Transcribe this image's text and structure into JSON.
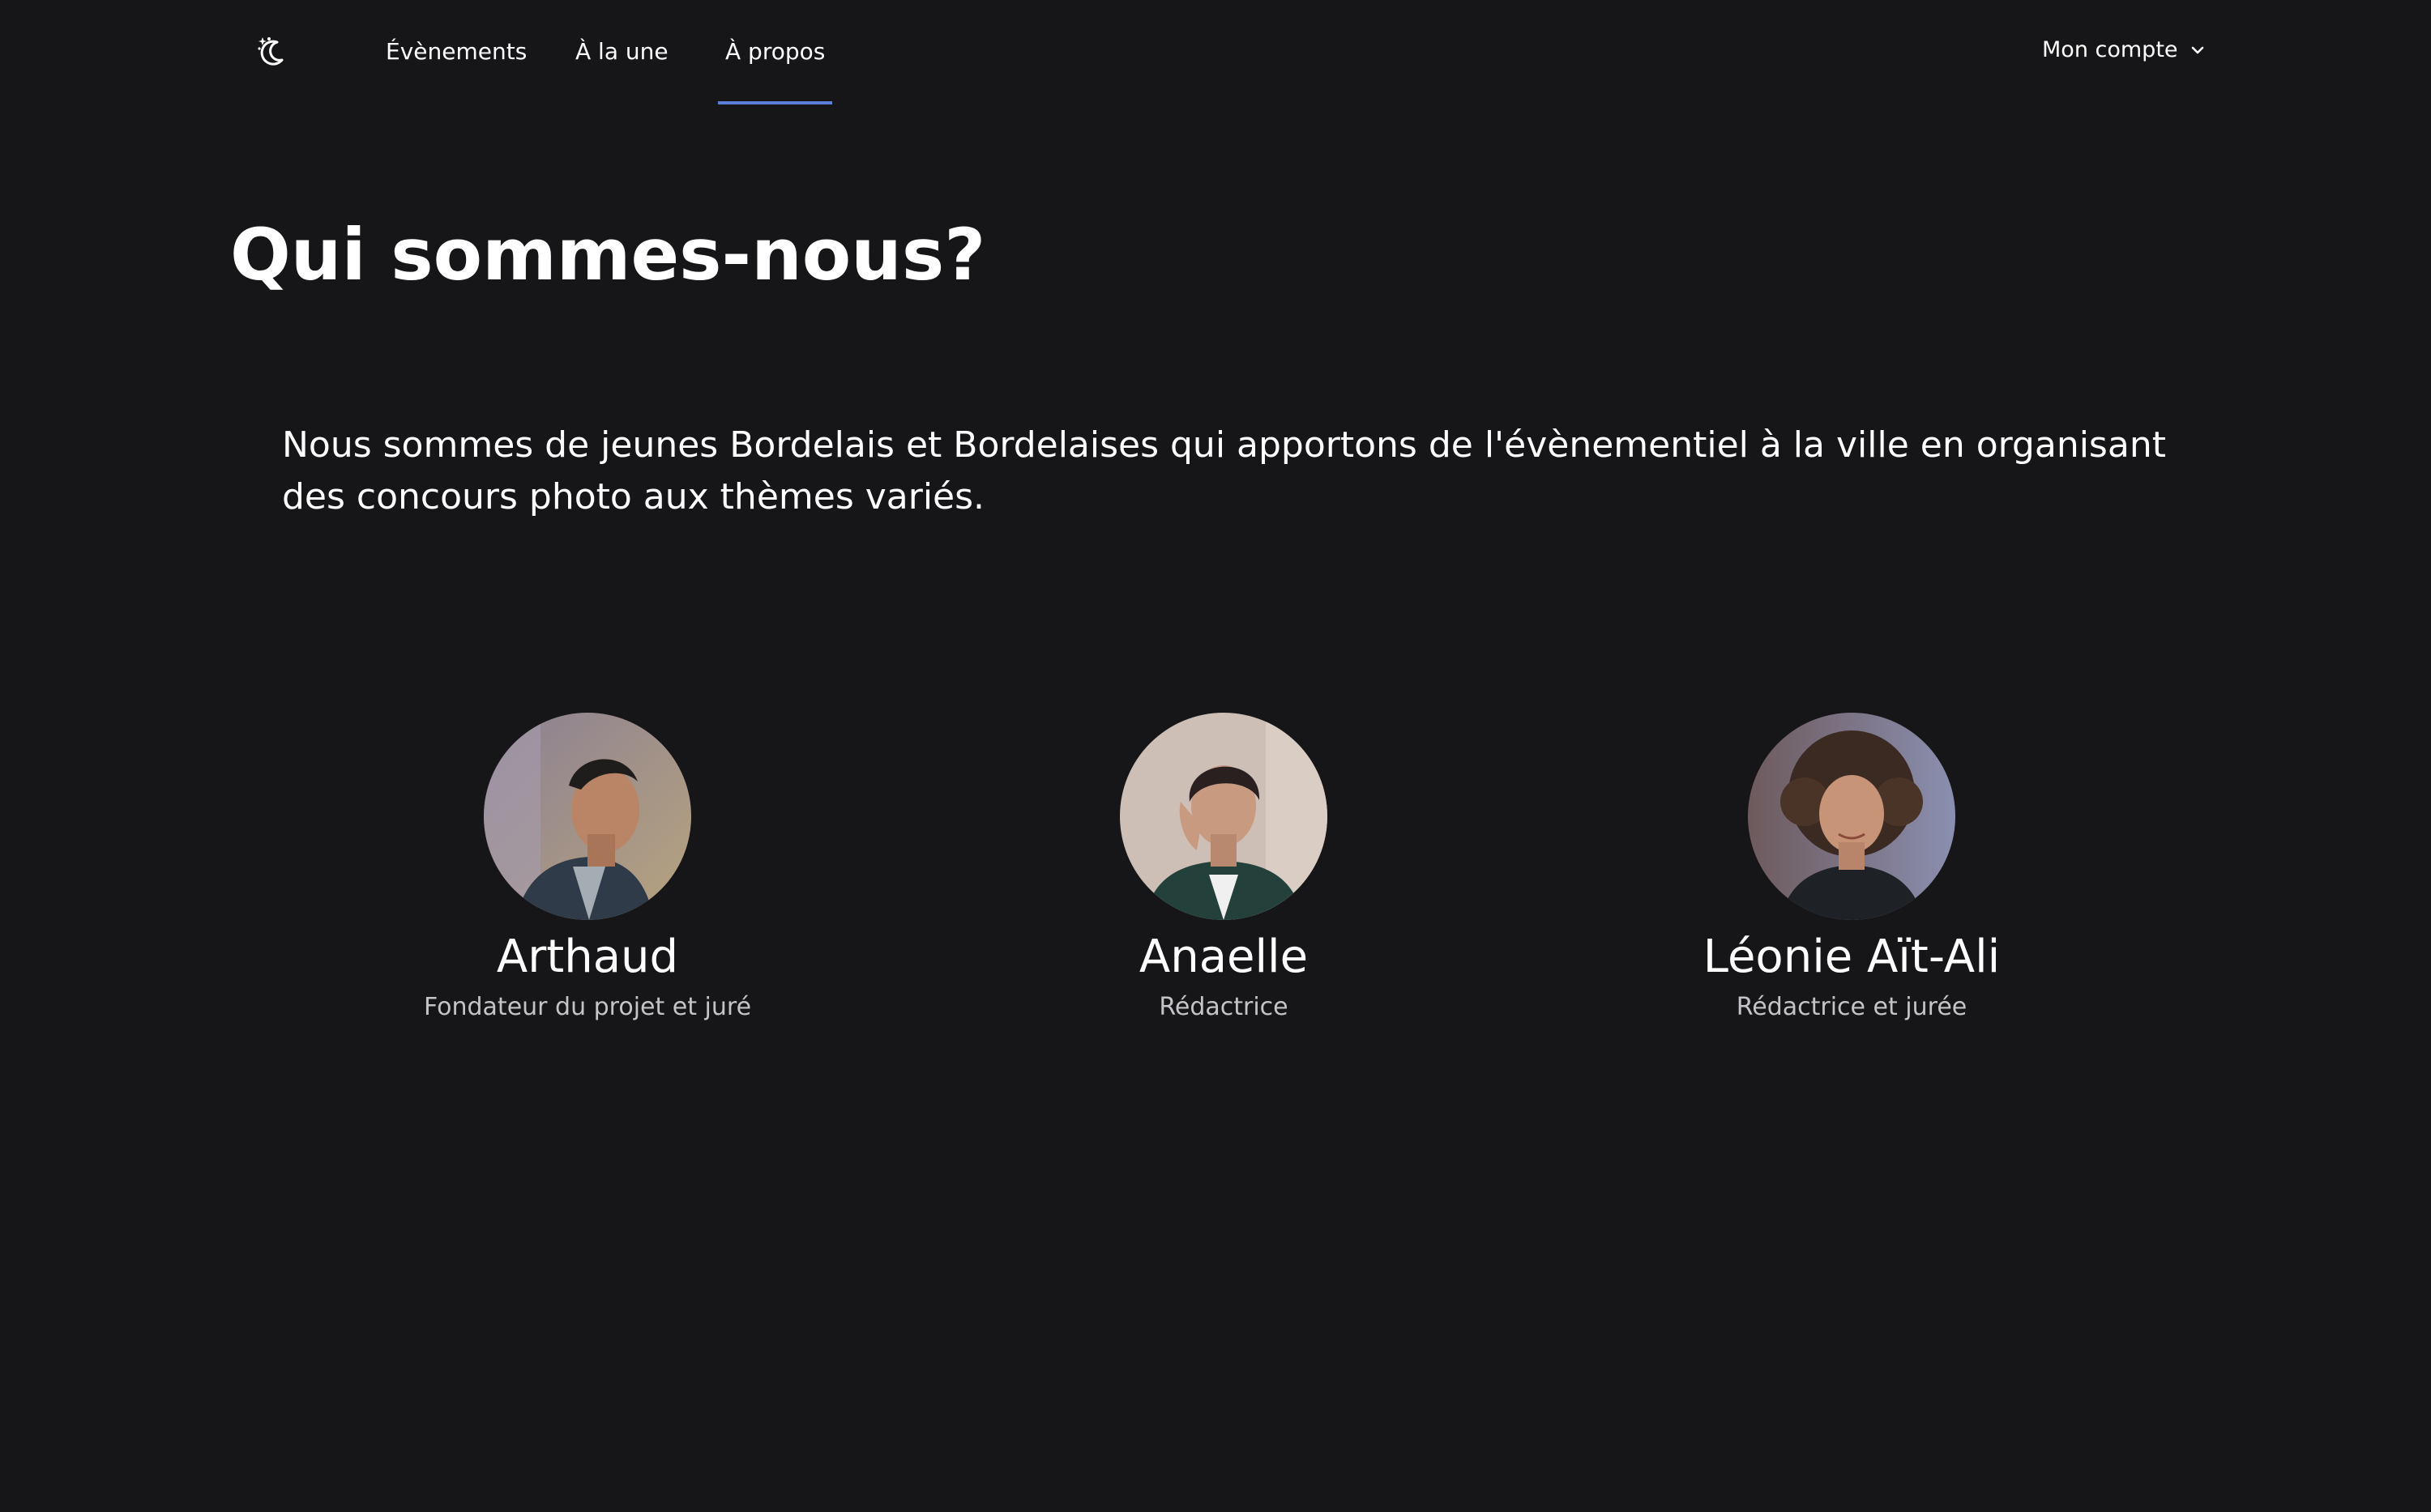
{
  "nav": {
    "logo_icon": "moon-stars-icon",
    "links": [
      {
        "label": "Évènements"
      },
      {
        "label": "À la une"
      },
      {
        "label": "À propos",
        "active": true
      }
    ],
    "account_label": "Mon compte",
    "account_icon": "chevron-down-icon",
    "accent_color": "#5b7fd6"
  },
  "page": {
    "title": "Qui sommes-nous?",
    "intro": "Nous sommes de jeunes Bordelais et Bordelaises qui apportons de l'évènementiel à la ville en organisant des concours photo aux thèmes variés."
  },
  "team": [
    {
      "name": "Arthaud",
      "role": "Fondateur du projet et juré"
    },
    {
      "name": "Anaelle",
      "role": "Rédactrice"
    },
    {
      "name": "Léonie Aït-Ali",
      "role": "Rédactrice et jurée"
    }
  ],
  "colors": {
    "background": "#161619",
    "text": "#ffffff",
    "muted_text": "#c4c4c8"
  }
}
